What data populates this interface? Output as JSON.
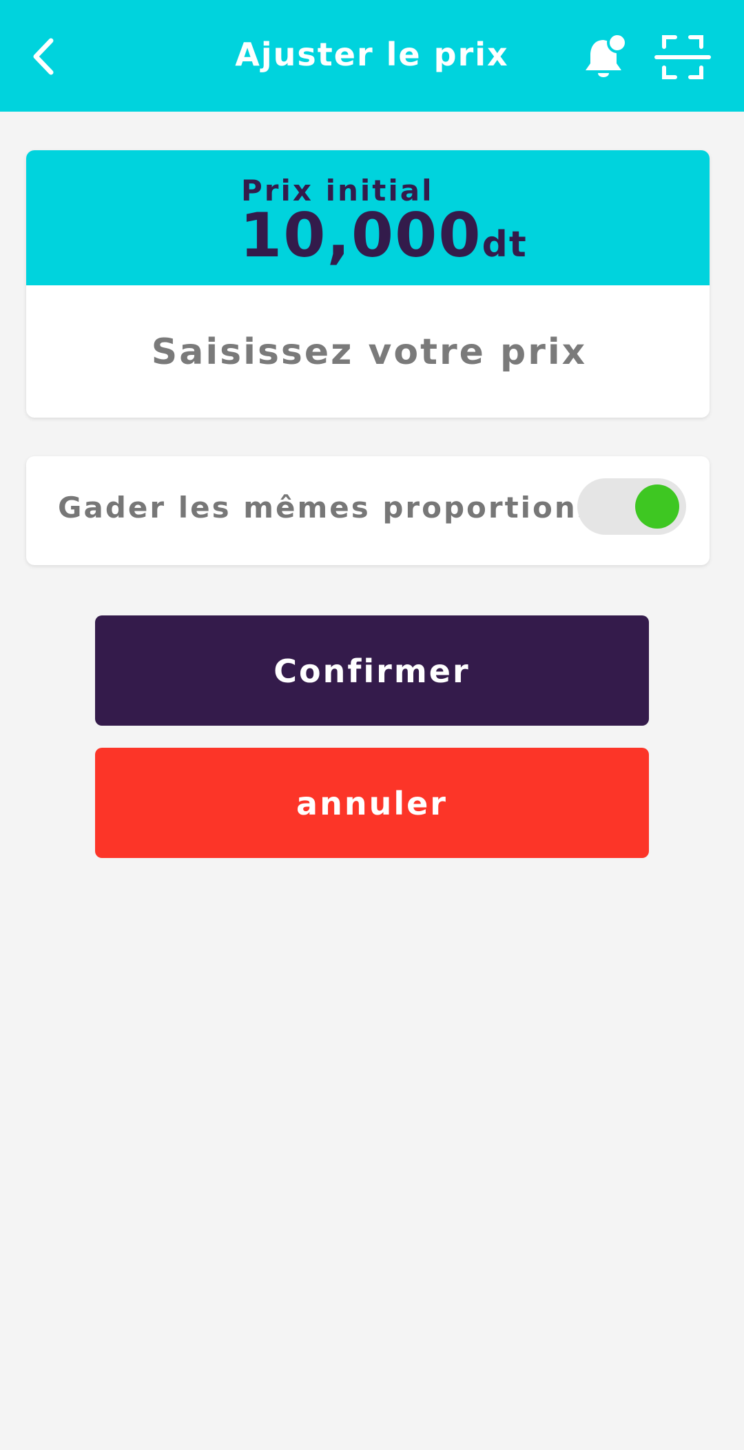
{
  "header": {
    "title": "Ajuster le prix",
    "back_icon": "chevron-left-icon",
    "notification_icon": "bell-icon",
    "scan_icon": "scan-frame-icon",
    "background_color": "#00d3dd"
  },
  "price_card": {
    "label": "Prix initial",
    "amount": "10,000",
    "currency": "dt",
    "input": {
      "value": "",
      "placeholder": "Saisissez votre prix"
    }
  },
  "proportions": {
    "label": "Gader les mêmes proportions",
    "enabled": true,
    "toggle_on_color": "#3ec722"
  },
  "actions": {
    "confirm_label": "Confirmer",
    "confirm_color": "#341b4b",
    "cancel_label": "annuler",
    "cancel_color": "#fc3528"
  }
}
